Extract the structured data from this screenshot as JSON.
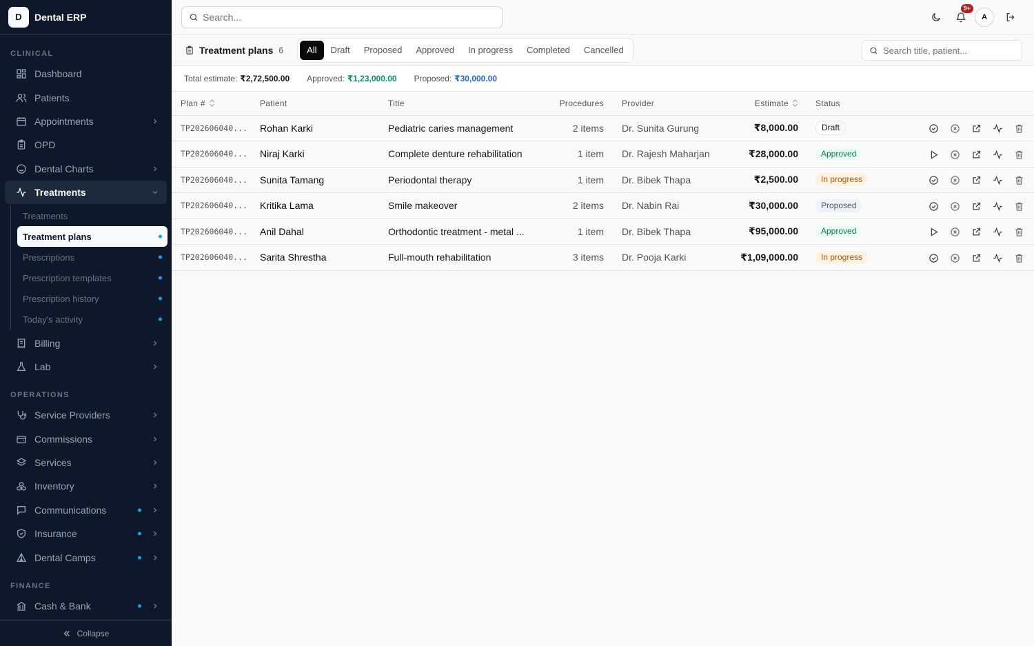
{
  "app": {
    "logo_letter": "D",
    "name": "Dental ERP"
  },
  "sidebar": {
    "sections": [
      {
        "label": "CLINICAL"
      },
      {
        "label": "OPERATIONS"
      },
      {
        "label": "FINANCE"
      }
    ],
    "clinical": [
      {
        "label": "Dashboard",
        "icon": "dashboard-icon"
      },
      {
        "label": "Patients",
        "icon": "users-icon"
      },
      {
        "label": "Appointments",
        "icon": "calendar-icon"
      },
      {
        "label": "OPD",
        "icon": "clipboard-icon"
      },
      {
        "label": "Dental Charts",
        "icon": "smile-icon"
      },
      {
        "label": "Treatments",
        "icon": "activity-icon"
      },
      {
        "label": "Billing",
        "icon": "receipt-icon"
      },
      {
        "label": "Lab",
        "icon": "flask-icon"
      }
    ],
    "treatments_sub": [
      {
        "label": "Treatments"
      },
      {
        "label": "Treatment plans"
      },
      {
        "label": "Prescriptions"
      },
      {
        "label": "Prescription templates"
      },
      {
        "label": "Prescription history"
      },
      {
        "label": "Today's activity"
      }
    ],
    "operations": [
      {
        "label": "Service Providers",
        "icon": "stethoscope-icon"
      },
      {
        "label": "Commissions",
        "icon": "wallet-icon"
      },
      {
        "label": "Services",
        "icon": "layers-icon"
      },
      {
        "label": "Inventory",
        "icon": "boxes-icon"
      },
      {
        "label": "Communications",
        "icon": "message-icon"
      },
      {
        "label": "Insurance",
        "icon": "shield-icon"
      },
      {
        "label": "Dental Camps",
        "icon": "tent-icon"
      }
    ],
    "finance": [
      {
        "label": "Cash & Bank",
        "icon": "bank-icon"
      }
    ],
    "collapse_label": "Collapse"
  },
  "topbar": {
    "search_placeholder": "Search...",
    "notification_badge": "9+",
    "avatar_letter": "A"
  },
  "toolbar": {
    "title": "Treatment plans",
    "count": "6",
    "tabs": [
      "All",
      "Draft",
      "Proposed",
      "Approved",
      "In progress",
      "Completed",
      "Cancelled"
    ],
    "active_tab": "All",
    "search_placeholder": "Search title, patient..."
  },
  "summary": {
    "total_label": "Total estimate:",
    "total_value": "₹2,72,500.00",
    "approved_label": "Approved:",
    "approved_value": "₹1,23,000.00",
    "proposed_label": "Proposed:",
    "proposed_value": "₹30,000.00"
  },
  "table": {
    "headers": {
      "plan": "Plan #",
      "patient": "Patient",
      "title": "Title",
      "procedures": "Procedures",
      "provider": "Provider",
      "estimate": "Estimate",
      "status": "Status"
    },
    "rows": [
      {
        "plan": "TP202606040...",
        "patient": "Rohan Karki",
        "title": "Pediatric caries management",
        "procedures": "2 items",
        "provider": "Dr. Sunita Gurung",
        "estimate": "₹8,000.00",
        "status": "Draft"
      },
      {
        "plan": "TP202606040...",
        "patient": "Niraj Karki",
        "title": "Complete denture rehabilitation",
        "procedures": "1 item",
        "provider": "Dr. Rajesh Maharjan",
        "estimate": "₹28,000.00",
        "status": "Approved"
      },
      {
        "plan": "TP202606040...",
        "patient": "Sunita Tamang",
        "title": "Periodontal therapy",
        "procedures": "1 item",
        "provider": "Dr. Bibek Thapa",
        "estimate": "₹2,500.00",
        "status": "In progress"
      },
      {
        "plan": "TP202606040...",
        "patient": "Kritika Lama",
        "title": "Smile makeover",
        "procedures": "2 items",
        "provider": "Dr. Nabin Rai",
        "estimate": "₹30,000.00",
        "status": "Proposed"
      },
      {
        "plan": "TP202606040...",
        "patient": "Anil Dahal",
        "title": "Orthodontic treatment - metal ...",
        "procedures": "1 item",
        "provider": "Dr. Bibek Thapa",
        "estimate": "₹95,000.00",
        "status": "Approved"
      },
      {
        "plan": "TP202606040...",
        "patient": "Sarita Shrestha",
        "title": "Full-mouth rehabilitation",
        "procedures": "3 items",
        "provider": "Dr. Pooja Karki",
        "estimate": "₹1,09,000.00",
        "status": "In progress"
      }
    ]
  },
  "colors": {
    "sidebar_bg": "#0f172a",
    "accent_dot": "#0ea5e9",
    "approved_text": "#059669",
    "proposed_text": "#2563eb",
    "badge_red": "#b91c1c"
  }
}
